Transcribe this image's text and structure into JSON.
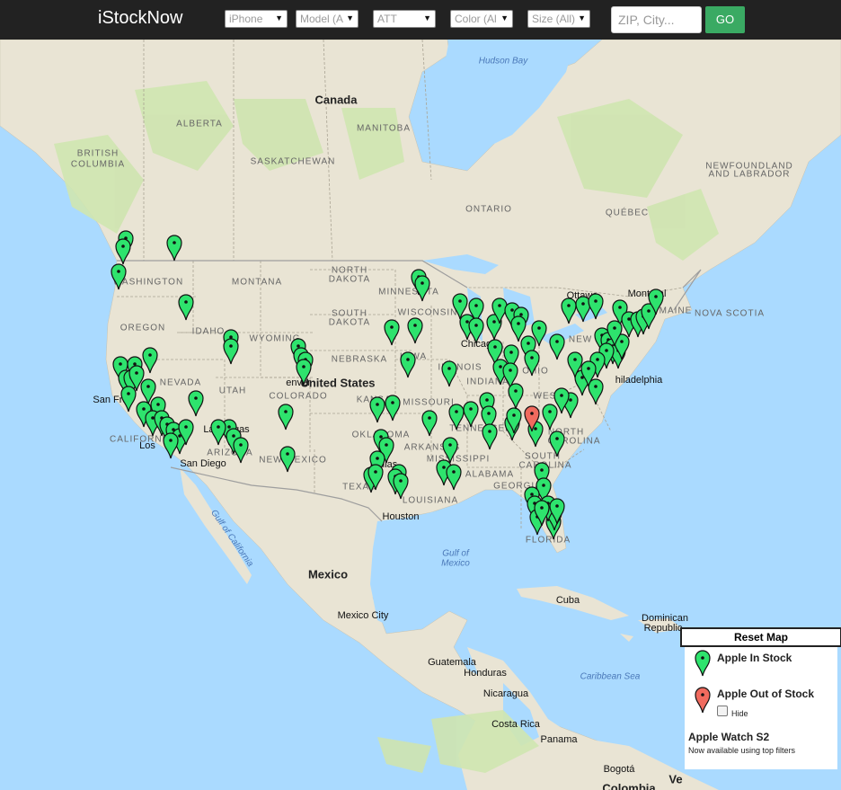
{
  "header": {
    "brand": "iStockNow",
    "filters": {
      "device": "iPhone",
      "model": "Model (A",
      "carrier": "ATT",
      "color": "Color (Al",
      "size": "Size (All)"
    },
    "search_placeholder": "ZIP, City...",
    "go_label": "GO"
  },
  "map": {
    "colors": {
      "land": "#e9e4d4",
      "water": "#aadaff",
      "park": "#cfe5b0",
      "border": "#9e9e9e",
      "pin_in": "#2ee36d",
      "pin_out": "#f06a5e"
    },
    "labels": {
      "canada": "Canada",
      "united_states": "United States",
      "mexico": "Mexico",
      "cuba": "Cuba",
      "guatemala": "Guatemala",
      "honduras": "Honduras",
      "nicaragua": "Nicaragua",
      "costa_rica": "Costa Rica",
      "panama": "Panama",
      "dominican_republic": "Dominican",
      "dominican_republic_2": "Republic",
      "alberta": "ALBERTA",
      "british_columbia": "BRITISH",
      "british_columbia_2": "COLUMBIA",
      "saskatchewan": "SASKATCHEWAN",
      "manitoba": "MANITOBA",
      "ontario": "ONTARIO",
      "quebec": "QUÉBEC",
      "newfoundland": "NEWFOUNDLAND",
      "newfoundland_2": "AND LABRADOR",
      "nova_scotia": "NOVA SCOTIA",
      "maine": "MAINE",
      "washington": "WASHINGTON",
      "oregon": "OREGON",
      "idaho": "IDAHO",
      "montana": "MONTANA",
      "wyoming": "WYOMING",
      "nevada": "NEVADA",
      "utah": "UTAH",
      "colorado": "COLORADO",
      "california": "CALIFORNIA",
      "arizona": "ARIZONA",
      "new_mexico": "NEW MEXICO",
      "north_dakota": "NORTH",
      "north_dakota_2": "DAKOTA",
      "south_dakota": "SOUTH",
      "south_dakota_2": "DAKOTA",
      "nebraska": "NEBRASKA",
      "kansas": "KANSAS",
      "oklahoma": "OKLAHOMA",
      "texas": "TEXAS",
      "minnesota": "MINNESOTA",
      "iowa": "IOWA",
      "missouri": "MISSOURI",
      "arkansas": "ARKANSAS",
      "louisiana": "LOUISIANA",
      "wisconsin": "WISCONSIN",
      "illinois": "ILLINOIS",
      "indiana": "INDIANA",
      "ohio": "OHIO",
      "tennessee": "TENNESSEE",
      "mississippi": "MISSISSIPPI",
      "alabama": "ALABAMA",
      "georgia": "GEORGIA",
      "florida": "FLORIDA",
      "west_virginia": "WEST",
      "north_carolina": "NORTH",
      "north_carolina_2": "CAROLINA",
      "south_carolina": "SOUTH",
      "south_carolina_2": "CAROLINA",
      "new_york": "NEW YORK",
      "hudson_bay": "Hudson Bay",
      "gulf_of_mexico": "Gulf of",
      "gulf_of_mexico_2": "Mexico",
      "gulf_of_california": "Gulf of California",
      "caribbean_sea": "Caribbean Sea",
      "san_francisco": "San Fra",
      "las_vegas": "Las Vegas",
      "los_angeles": "Los",
      "san_diego": "San Diego",
      "denver": "enver",
      "dallas": "Dallas",
      "houston": "Houston",
      "chicago": "Chicago",
      "ottawa": "Ottawa",
      "montreal": "Montreal",
      "philadelphia": "hiladelphia",
      "mexico_city": "Mexico City",
      "bogota": "Bogotá",
      "colombia": "Colombia",
      "venezuela": "Ve"
    }
  },
  "legend": {
    "reset_label": "Reset Map",
    "in_stock": "Apple In Stock",
    "out_of_stock": "Apple Out of Stock",
    "hide_label": "Hide",
    "watch_title": "Apple Watch S2",
    "watch_sub": "Now available using top filters"
  }
}
